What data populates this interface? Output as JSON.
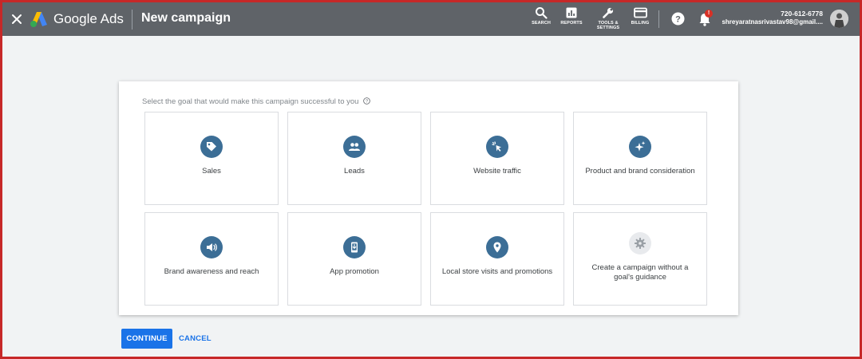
{
  "header": {
    "brand": "Google Ads",
    "title": "New campaign",
    "tools": [
      {
        "label": "SEARCH",
        "icon": "search-icon"
      },
      {
        "label": "REPORTS",
        "icon": "reports-icon"
      },
      {
        "label": "TOOLS &",
        "label2": "SETTINGS",
        "icon": "wrench-icon"
      },
      {
        "label": "BILLING",
        "icon": "credit-card-icon"
      }
    ],
    "notification_badge": "!",
    "account_phone": "720-612-6778",
    "account_email": "shreyaratnasrivastav98@gmail...."
  },
  "main": {
    "prompt": "Select the goal that would make this campaign successful to you",
    "goals": [
      {
        "label": "Sales",
        "icon": "sales-tag-icon"
      },
      {
        "label": "Leads",
        "icon": "people-icon"
      },
      {
        "label": "Website traffic",
        "icon": "cursor-click-icon"
      },
      {
        "label": "Product and brand consideration",
        "icon": "sparkle-icon"
      },
      {
        "label": "Brand awareness and reach",
        "icon": "megaphone-icon"
      },
      {
        "label": "App promotion",
        "icon": "mobile-download-icon"
      },
      {
        "label": "Local store visits and promotions",
        "icon": "location-pin-icon"
      },
      {
        "label": "Create a campaign without a goal's guidance",
        "icon": "gear-icon"
      }
    ]
  },
  "footer": {
    "continue_label": "CONTINUE",
    "cancel_label": "CANCEL"
  },
  "colors": {
    "header_bg": "#5f6368",
    "accent": "#1a73e8",
    "goal_icon_bg": "#3c6e96",
    "frame_border": "#c62828"
  }
}
